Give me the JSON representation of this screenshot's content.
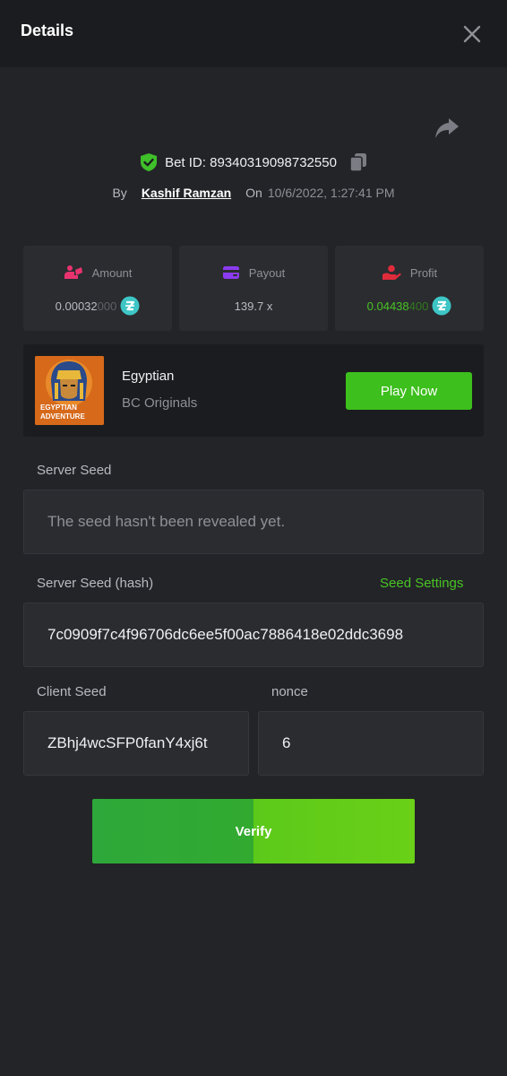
{
  "header": {
    "title": "Details"
  },
  "bet": {
    "id_text": "Bet ID: 89340319098732550",
    "by_label": "By",
    "user": "Kashif Ramzan",
    "on_label": "On",
    "date": "10/6/2022, 1:27:41 PM"
  },
  "stats": {
    "amount": {
      "label": "Amount",
      "value_main": "0.00032",
      "value_dim": "000"
    },
    "payout": {
      "label": "Payout",
      "value": "139.7 x"
    },
    "profit": {
      "label": "Profit",
      "value_main": "0.04438",
      "value_dim": "400"
    }
  },
  "game": {
    "name": "Egyptian",
    "provider": "BC Originals",
    "thumb_text_1": "EGYPTIAN",
    "thumb_text_2": "ADVENTURE",
    "play_label": "Play Now"
  },
  "seeds": {
    "server_seed_label": "Server Seed",
    "server_seed_value": "The seed hasn't been revealed yet.",
    "server_hash_label": "Server Seed (hash)",
    "seed_settings_label": "Seed Settings",
    "server_hash_value": "7c0909f7c4f96706dc6ee5f00ac7886418e02ddc3698",
    "client_seed_label": "Client Seed",
    "client_seed_value": "ZBhj4wcSFP0fanY4xj6t",
    "nonce_label": "nonce",
    "nonce_value": "6"
  },
  "verify_label": "Verify",
  "colors": {
    "background": "#232428",
    "header_bg": "#1b1c1f",
    "accent_green": "#3dbf1d",
    "shield_green": "#3fbf2a",
    "amount_icon": "#e8336f",
    "payout_icon": "#8b3bf0",
    "profit_icon": "#e02b3b",
    "coin": "#3ec6c6"
  },
  "icons": {
    "close": "close-icon",
    "share": "share-icon",
    "shield": "shield-check-icon",
    "copy": "copy-icon",
    "amount": "amount-icon",
    "payout": "wallet-icon",
    "profit": "profit-hand-icon",
    "coin": "coin-icon"
  }
}
